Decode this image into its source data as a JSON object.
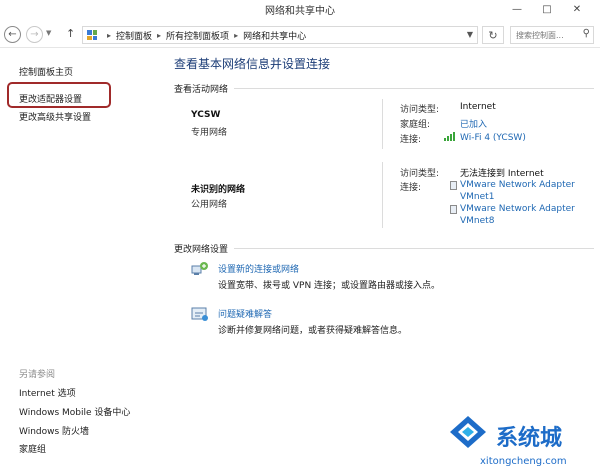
{
  "window": {
    "title": "网络和共享中心"
  },
  "address": {
    "crumbs": [
      "控制面板",
      "所有控制面板项",
      "网络和共享中心"
    ],
    "search_placeholder": "搜索控制面..."
  },
  "sidebar": {
    "items": [
      "控制面板主页",
      "更改适配器设置",
      "更改高级共享设置"
    ],
    "see_also_title": "另请参阅",
    "see_also": [
      "Internet 选项",
      "Windows Mobile 设备中心",
      "Windows 防火墙",
      "家庭组"
    ]
  },
  "main": {
    "title": "查看基本网络信息并设置连接",
    "active_header": "查看活动网络",
    "networks": [
      {
        "name": "YCSW",
        "type": "专用网络",
        "access_label": "访问类型:",
        "access_value": "Internet",
        "homegroup_label": "家庭组:",
        "homegroup_value": "已加入",
        "conn_label": "连接:",
        "conn_value": "Wi-Fi 4 (YCSW)"
      },
      {
        "name": "未识别的网络",
        "type": "公用网络",
        "access_label": "访问类型:",
        "access_value": "无法连接到 Internet",
        "conn_label": "连接:",
        "conn_values": [
          "VMware Network Adapter",
          "VMnet1",
          "VMware Network Adapter",
          "VMnet8"
        ]
      }
    ],
    "change_header": "更改网络设置",
    "tasks": [
      {
        "link": "设置新的连接或网络",
        "desc": "设置宽带、拨号或 VPN 连接；或设置路由器或接入点。"
      },
      {
        "link": "问题疑难解答",
        "desc": "诊断并修复网络问题，或者获得疑难解答信息。"
      }
    ]
  },
  "watermark": {
    "text": "系统城",
    "url": "xitongcheng.com"
  },
  "colors": {
    "link": "#1f68b3",
    "title": "#1c3d77",
    "highlight": "#a02a2a"
  }
}
